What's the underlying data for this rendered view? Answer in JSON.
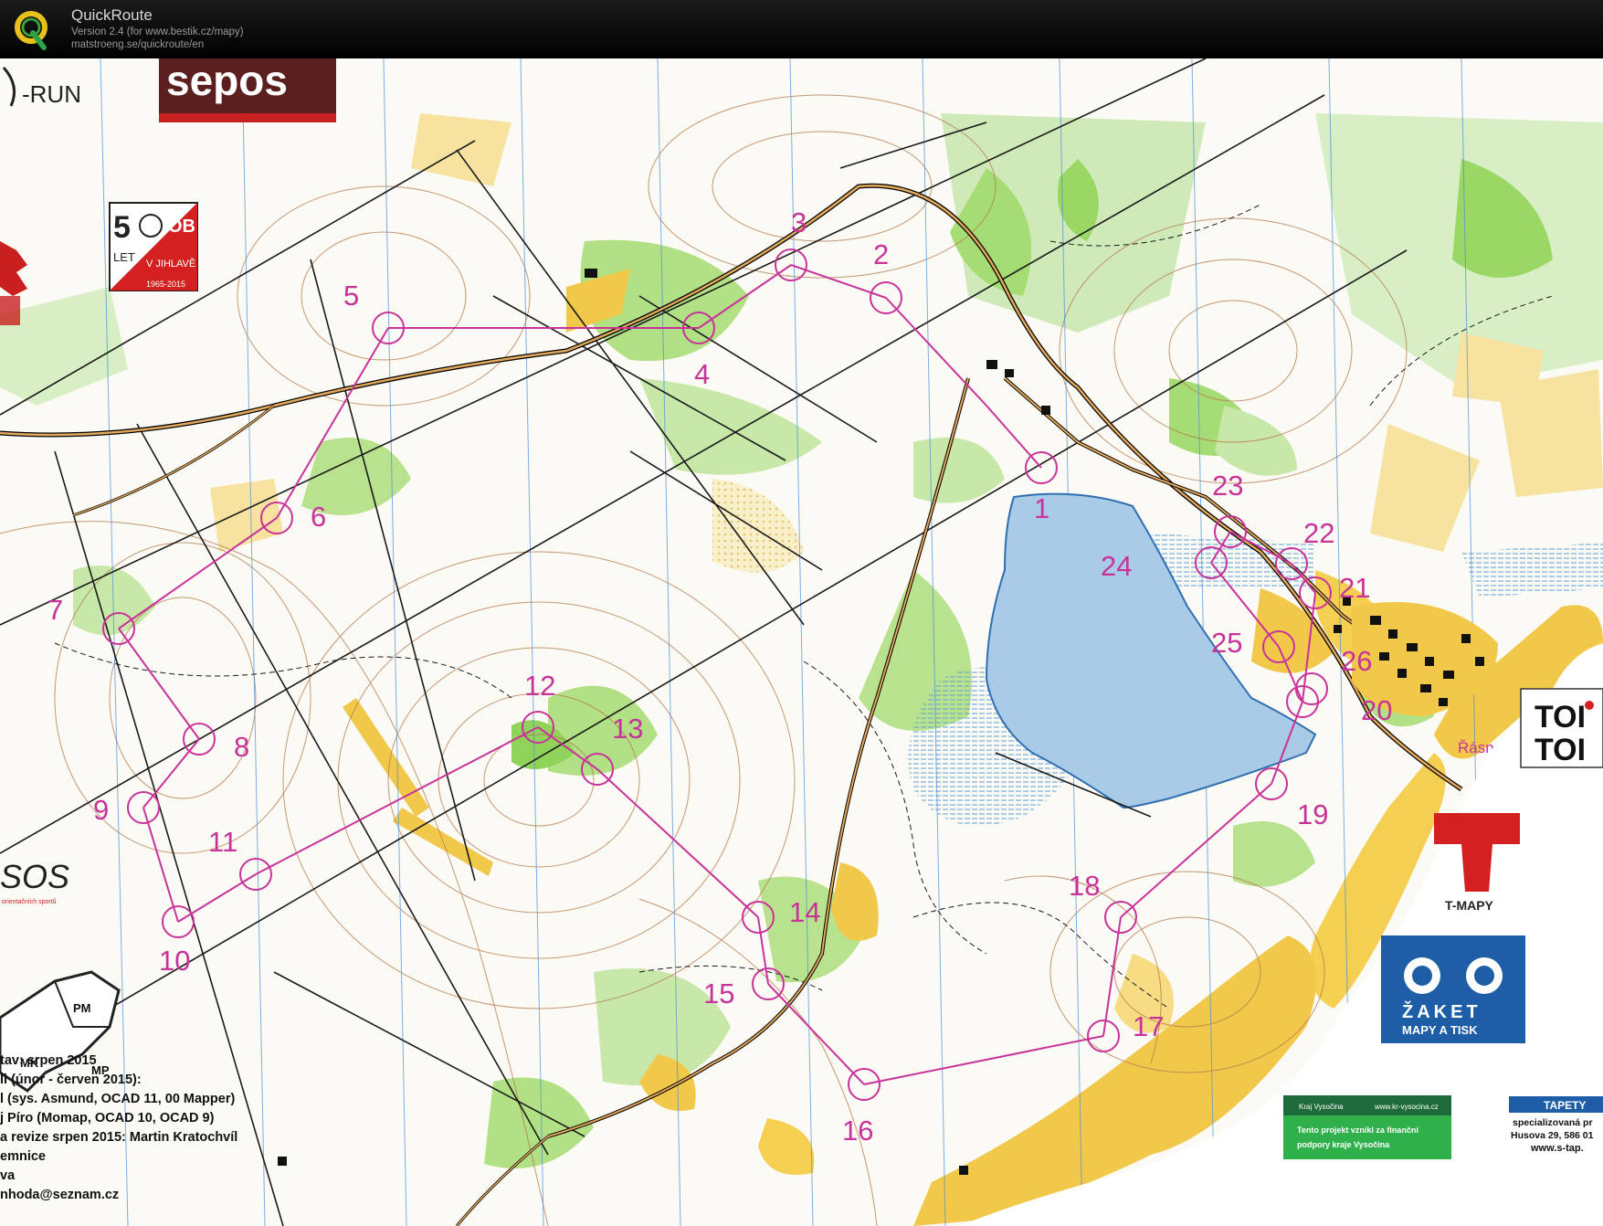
{
  "app": {
    "name": "QuickRoute",
    "version": "Version 2.4  (for www.bestik.cz/mapy)",
    "url": "matstroeng.se/quickroute/en"
  },
  "sponsors": {
    "sepos": "sepos",
    "run": "-RUN",
    "anniversary_number": "5",
    "anniversary_let": "LET",
    "anniversary_ob": "OB",
    "anniversary_city": "V JIHLAVĚ",
    "anniversary_years": "1965-2015",
    "sos": "SOS",
    "sos_sub": "orientačních sportů",
    "toi_line1": "TOI",
    "toi_line2": "TOI",
    "tmapy": "T-MAPY",
    "zaket": "ŽAKET",
    "zaket_sub": "MAPY A TISK",
    "kraj_name": "Kraj Vysočina",
    "kraj_url": "www.kr-vysocina.cz",
    "kraj_text1": "Tento projekt vznikl za finanční",
    "kraj_text2": "podpory kraje Vysočina",
    "tapety": "TAPETY",
    "tapety_line1": "specializovaná pr",
    "tapety_line2": "Husova 29, 586 01",
    "tapety_line3": "www.s-tap."
  },
  "place_name": "Řásná",
  "lake_label": "24",
  "inset": {
    "mk": "MK",
    "pm": "PM",
    "mp": "MP"
  },
  "info_lines": [
    "tav: srpen 2015",
    "li (únor - červen 2015):",
    "l (sys. Asmund, OCAD 11, 00  Mapper)",
    "j Píro (Momap, OCAD 10, OCAD 9)",
    "a revize srpen 2015: Martin Kratochvíl",
    "emnice",
    "va",
    "nhoda@seznam.cz"
  ],
  "controls": [
    {
      "n": "1"
    },
    {
      "n": "2"
    },
    {
      "n": "3"
    },
    {
      "n": "4"
    },
    {
      "n": "5"
    },
    {
      "n": "6"
    },
    {
      "n": "7"
    },
    {
      "n": "8"
    },
    {
      "n": "9"
    },
    {
      "n": "10"
    },
    {
      "n": "11"
    },
    {
      "n": "12"
    },
    {
      "n": "13"
    },
    {
      "n": "14"
    },
    {
      "n": "15"
    },
    {
      "n": "16"
    },
    {
      "n": "17"
    },
    {
      "n": "18"
    },
    {
      "n": "19"
    },
    {
      "n": "20"
    },
    {
      "n": "21"
    },
    {
      "n": "22"
    },
    {
      "n": "23"
    },
    {
      "n": "25"
    },
    {
      "n": "26"
    }
  ],
  "colors": {
    "course": "#c8339a",
    "forest_green": "#8fd35a",
    "open_yellow": "#f2c84a",
    "lake": "#a9cbe8",
    "contour": "#b5774a",
    "paper": "#fbfaf5"
  }
}
